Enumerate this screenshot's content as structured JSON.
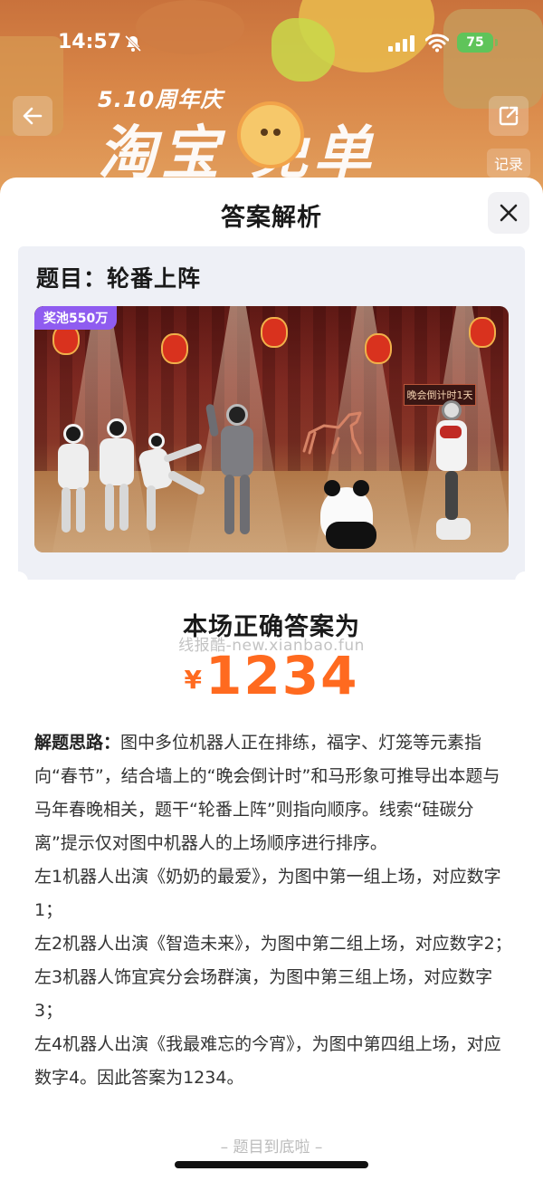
{
  "status_bar": {
    "time": "14:57",
    "battery": "75"
  },
  "banner": {
    "subtitle": "5.10周年庆",
    "headline": "淘宝  免单"
  },
  "top_actions": {
    "record_label": "记录"
  },
  "sheet": {
    "title": "答案解析",
    "question": {
      "title": "题目：轮番上阵",
      "prize_badge": "奖池550万",
      "scene_sign": "晚会倒计时1天"
    },
    "answer_heading": "本场正确答案为",
    "watermark": "线报酷-new.xianbao.fun",
    "answer_currency": "¥",
    "answer_value": "1234",
    "analysis": {
      "label": "解题思路：",
      "intro": "图中多位机器人正在排练，福字、灯笼等元素指向“春节”，结合墙上的“晚会倒计时”和马形象可推导出本题与马年春晚相关，题干“轮番上阵”则指向顺序。线索“硅碳分离”提示仅对图中机器人的上场顺序进行排序。",
      "lines": [
        "左1机器人出演《奶奶的最爱》，为图中第一组上场，对应数字1；",
        "左2机器人出演《智造未来》，为图中第二组上场，对应数字2；",
        "左3机器人饰宜宾分会场群演，为图中第三组上场，对应数字3；",
        "左4机器人出演《我最难忘的今宵》，为图中第四组上场，对应数字4。因此答案为1234。"
      ]
    },
    "end_note": "– 题目到底啦 –"
  },
  "colors": {
    "accent": "#ff6a1f",
    "badge": "#8f5cf0",
    "banner": "#d98748"
  }
}
